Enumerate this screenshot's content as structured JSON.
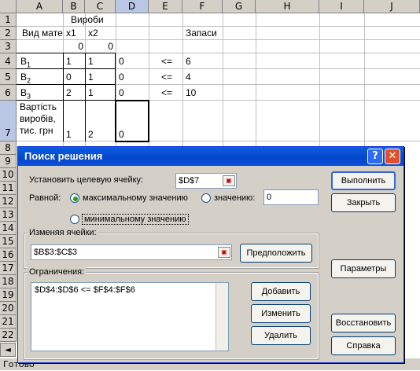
{
  "sheet": {
    "columns": [
      "A",
      "B",
      "C",
      "D",
      "E",
      "F",
      "G",
      "H",
      "I",
      "J"
    ],
    "rows": [
      "1",
      "2",
      "3",
      "4",
      "5",
      "6",
      "7",
      "8",
      "9",
      "10",
      "11",
      "12",
      "13",
      "14",
      "15",
      "16",
      "17",
      "18",
      "19",
      "20",
      "21",
      "22"
    ],
    "cells": {
      "B1": "Вироби",
      "A2": "Вид мате",
      "B2": "x1",
      "C2": "x2",
      "F2": "Запаси",
      "B3": "0",
      "C3": "0",
      "A4_base": "B",
      "A4_sub": "1",
      "B4": "1",
      "C4": "1",
      "D4": "0",
      "E4": "<=",
      "F4": "6",
      "A5_base": "B",
      "A5_sub": "2",
      "B5": "0",
      "C5": "1",
      "D5": "0",
      "E5": "<=",
      "F5": "4",
      "A6_base": "B",
      "A6_sub": "3",
      "B6": "2",
      "C6": "1",
      "D6": "0",
      "E6": "<=",
      "F6": "10",
      "A7": "Вартість виробів, тис. грн",
      "B7": "1",
      "C7": "2",
      "D7": "0"
    },
    "status": "Готово",
    "tab_nav": "◄"
  },
  "dialog": {
    "title": "Поиск решения",
    "help_glyph": "?",
    "close_glyph": "✕",
    "target_label": "Установить целевую ячейку:",
    "target_value": "$D$7",
    "equal_label": "Равной:",
    "opt_max": "максимальному значению",
    "opt_value": "значению:",
    "value_field": "0",
    "opt_min": "минимальному значению",
    "changing_label": "Изменяя ячейки:",
    "changing_value": "$B$3:$C$3",
    "guess_btn": "Предположить",
    "constraints_label": "Ограничения:",
    "constraints": [
      "$D$4:$D$6 <= $F$4:$F$6"
    ],
    "add_btn": "Добавить",
    "change_btn": "Изменить",
    "delete_btn": "Удалить",
    "run_btn": "Выполнить",
    "close_btn": "Закрыть",
    "params_btn": "Параметры",
    "reset_btn": "Восстановить",
    "help_btn": "Справка",
    "selected_option": "max"
  }
}
